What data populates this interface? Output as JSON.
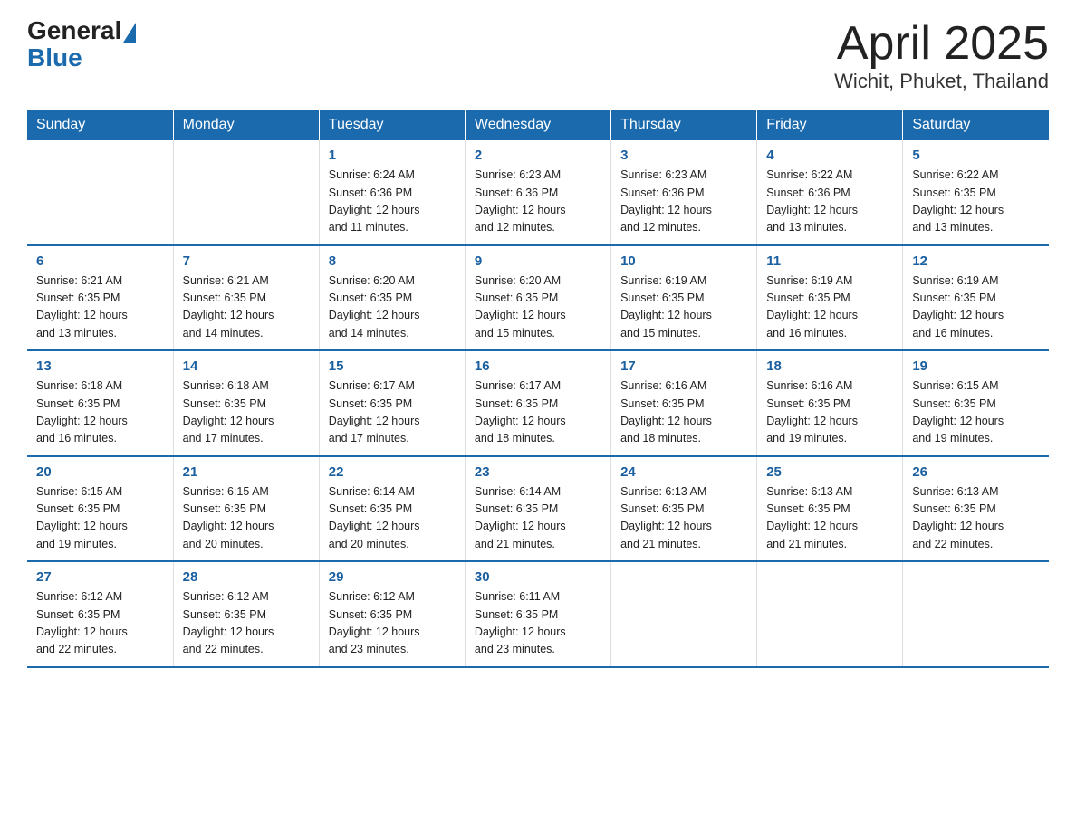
{
  "header": {
    "logo_general": "General",
    "logo_blue": "Blue",
    "title": "April 2025",
    "location": "Wichit, Phuket, Thailand"
  },
  "weekdays": [
    "Sunday",
    "Monday",
    "Tuesday",
    "Wednesday",
    "Thursday",
    "Friday",
    "Saturday"
  ],
  "weeks": [
    [
      {
        "day": "",
        "info": ""
      },
      {
        "day": "",
        "info": ""
      },
      {
        "day": "1",
        "info": "Sunrise: 6:24 AM\nSunset: 6:36 PM\nDaylight: 12 hours\nand 11 minutes."
      },
      {
        "day": "2",
        "info": "Sunrise: 6:23 AM\nSunset: 6:36 PM\nDaylight: 12 hours\nand 12 minutes."
      },
      {
        "day": "3",
        "info": "Sunrise: 6:23 AM\nSunset: 6:36 PM\nDaylight: 12 hours\nand 12 minutes."
      },
      {
        "day": "4",
        "info": "Sunrise: 6:22 AM\nSunset: 6:36 PM\nDaylight: 12 hours\nand 13 minutes."
      },
      {
        "day": "5",
        "info": "Sunrise: 6:22 AM\nSunset: 6:35 PM\nDaylight: 12 hours\nand 13 minutes."
      }
    ],
    [
      {
        "day": "6",
        "info": "Sunrise: 6:21 AM\nSunset: 6:35 PM\nDaylight: 12 hours\nand 13 minutes."
      },
      {
        "day": "7",
        "info": "Sunrise: 6:21 AM\nSunset: 6:35 PM\nDaylight: 12 hours\nand 14 minutes."
      },
      {
        "day": "8",
        "info": "Sunrise: 6:20 AM\nSunset: 6:35 PM\nDaylight: 12 hours\nand 14 minutes."
      },
      {
        "day": "9",
        "info": "Sunrise: 6:20 AM\nSunset: 6:35 PM\nDaylight: 12 hours\nand 15 minutes."
      },
      {
        "day": "10",
        "info": "Sunrise: 6:19 AM\nSunset: 6:35 PM\nDaylight: 12 hours\nand 15 minutes."
      },
      {
        "day": "11",
        "info": "Sunrise: 6:19 AM\nSunset: 6:35 PM\nDaylight: 12 hours\nand 16 minutes."
      },
      {
        "day": "12",
        "info": "Sunrise: 6:19 AM\nSunset: 6:35 PM\nDaylight: 12 hours\nand 16 minutes."
      }
    ],
    [
      {
        "day": "13",
        "info": "Sunrise: 6:18 AM\nSunset: 6:35 PM\nDaylight: 12 hours\nand 16 minutes."
      },
      {
        "day": "14",
        "info": "Sunrise: 6:18 AM\nSunset: 6:35 PM\nDaylight: 12 hours\nand 17 minutes."
      },
      {
        "day": "15",
        "info": "Sunrise: 6:17 AM\nSunset: 6:35 PM\nDaylight: 12 hours\nand 17 minutes."
      },
      {
        "day": "16",
        "info": "Sunrise: 6:17 AM\nSunset: 6:35 PM\nDaylight: 12 hours\nand 18 minutes."
      },
      {
        "day": "17",
        "info": "Sunrise: 6:16 AM\nSunset: 6:35 PM\nDaylight: 12 hours\nand 18 minutes."
      },
      {
        "day": "18",
        "info": "Sunrise: 6:16 AM\nSunset: 6:35 PM\nDaylight: 12 hours\nand 19 minutes."
      },
      {
        "day": "19",
        "info": "Sunrise: 6:15 AM\nSunset: 6:35 PM\nDaylight: 12 hours\nand 19 minutes."
      }
    ],
    [
      {
        "day": "20",
        "info": "Sunrise: 6:15 AM\nSunset: 6:35 PM\nDaylight: 12 hours\nand 19 minutes."
      },
      {
        "day": "21",
        "info": "Sunrise: 6:15 AM\nSunset: 6:35 PM\nDaylight: 12 hours\nand 20 minutes."
      },
      {
        "day": "22",
        "info": "Sunrise: 6:14 AM\nSunset: 6:35 PM\nDaylight: 12 hours\nand 20 minutes."
      },
      {
        "day": "23",
        "info": "Sunrise: 6:14 AM\nSunset: 6:35 PM\nDaylight: 12 hours\nand 21 minutes."
      },
      {
        "day": "24",
        "info": "Sunrise: 6:13 AM\nSunset: 6:35 PM\nDaylight: 12 hours\nand 21 minutes."
      },
      {
        "day": "25",
        "info": "Sunrise: 6:13 AM\nSunset: 6:35 PM\nDaylight: 12 hours\nand 21 minutes."
      },
      {
        "day": "26",
        "info": "Sunrise: 6:13 AM\nSunset: 6:35 PM\nDaylight: 12 hours\nand 22 minutes."
      }
    ],
    [
      {
        "day": "27",
        "info": "Sunrise: 6:12 AM\nSunset: 6:35 PM\nDaylight: 12 hours\nand 22 minutes."
      },
      {
        "day": "28",
        "info": "Sunrise: 6:12 AM\nSunset: 6:35 PM\nDaylight: 12 hours\nand 22 minutes."
      },
      {
        "day": "29",
        "info": "Sunrise: 6:12 AM\nSunset: 6:35 PM\nDaylight: 12 hours\nand 23 minutes."
      },
      {
        "day": "30",
        "info": "Sunrise: 6:11 AM\nSunset: 6:35 PM\nDaylight: 12 hours\nand 23 minutes."
      },
      {
        "day": "",
        "info": ""
      },
      {
        "day": "",
        "info": ""
      },
      {
        "day": "",
        "info": ""
      }
    ]
  ]
}
